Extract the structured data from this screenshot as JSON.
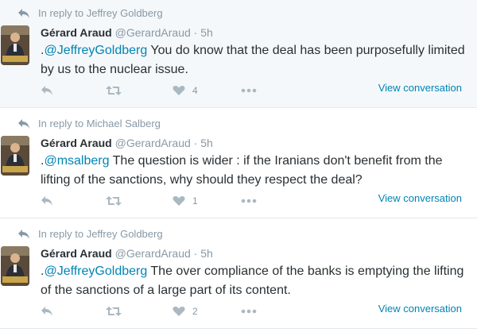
{
  "tweets": [
    {
      "reply_label": "In reply to Jeffrey Goldberg",
      "name": "Gérard Araud",
      "handle": "@GerardAraud",
      "time": "5h",
      "prefix": ".",
      "mention": "@JeffreyGoldberg",
      "body": " You do know that the deal has been purposefully limited by us to the nuclear issue.",
      "likes": "4",
      "view_label": "View conversation"
    },
    {
      "reply_label": "In reply to Michael Salberg",
      "name": "Gérard Araud",
      "handle": "@GerardAraud",
      "time": "5h",
      "prefix": ".",
      "mention": "@msalberg",
      "body": " The question is wider : if the Iranians don't benefit from the lifting of the sanctions, why should they respect the deal?",
      "likes": "1",
      "view_label": "View conversation"
    },
    {
      "reply_label": "In reply to Jeffrey Goldberg",
      "name": "Gérard Araud",
      "handle": "@GerardAraud",
      "time": "5h",
      "prefix": ".",
      "mention": "@JeffreyGoldberg",
      "body": " The over compliance of the banks is emptying the lifting of the sanctions of a large part of its content.",
      "likes": "2",
      "view_label": "View conversation"
    }
  ],
  "separator": "·",
  "icons": {
    "reply_context": "reply-arrow-icon",
    "reply": "reply-icon",
    "retweet": "retweet-icon",
    "like": "heart-icon",
    "more": "more-dots-icon"
  },
  "colors": {
    "link": "#0084b4",
    "muted": "#8899a6",
    "icon": "#aab8c2",
    "text": "#292f33"
  }
}
